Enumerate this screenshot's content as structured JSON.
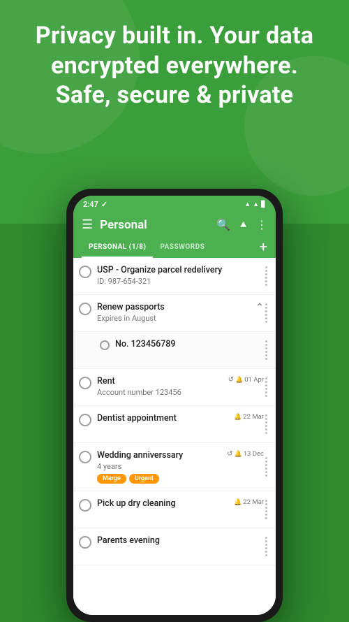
{
  "hero": {
    "text": "Privacy built in. Your data encrypted everywhere.\nSafe, secure & private"
  },
  "status_bar": {
    "time": "2:47",
    "check": "✓"
  },
  "top_bar": {
    "title": "Personal",
    "hamburger": "≡",
    "search_icon": "🔍",
    "share_icon": "⇧",
    "more_icon": "⋮"
  },
  "tabs": {
    "personal": "PERSONAL (1/8)",
    "passwords": "PASSWORDS",
    "add": "+"
  },
  "list_items": [
    {
      "id": 1,
      "title": "USP - Organize parcel redelivery",
      "subtitle": "ID: 987-654-321",
      "date_right": null,
      "recurring": false,
      "has_bell": false,
      "tags": [],
      "expanded": true
    },
    {
      "id": 2,
      "title": "Renew passports",
      "subtitle": "Expires in August",
      "date_right": null,
      "recurring": false,
      "has_bell": false,
      "tags": [],
      "expanded": true,
      "has_collapse": true
    },
    {
      "id": 3,
      "title": "No. 123456789",
      "subtitle": null,
      "indented": true,
      "date_right": null,
      "recurring": false,
      "has_bell": false,
      "tags": [],
      "sub": true
    },
    {
      "id": 4,
      "title": "Rent",
      "subtitle": "Account number 123456",
      "date_right": "01 Apr",
      "recurring": true,
      "has_bell": true,
      "tags": []
    },
    {
      "id": 5,
      "title": "Dentist appointment",
      "subtitle": null,
      "date_right": "22 Mar",
      "recurring": false,
      "has_bell": true,
      "tags": []
    },
    {
      "id": 6,
      "title": "Wedding anniverssary",
      "subtitle": "4 years",
      "date_right": "13 Dec",
      "recurring": true,
      "has_bell": true,
      "tags": [
        "Marge",
        "Urgent"
      ]
    },
    {
      "id": 7,
      "title": "Pick up dry cleaning",
      "subtitle": null,
      "date_right": "22 Mar",
      "recurring": false,
      "has_bell": true,
      "tags": []
    },
    {
      "id": 8,
      "title": "Parents evening",
      "subtitle": null,
      "date_right": null,
      "recurring": false,
      "has_bell": false,
      "tags": []
    }
  ],
  "colors": {
    "green": "#4caf50",
    "dark_green": "#388e3c",
    "orange": "#ff9800"
  }
}
